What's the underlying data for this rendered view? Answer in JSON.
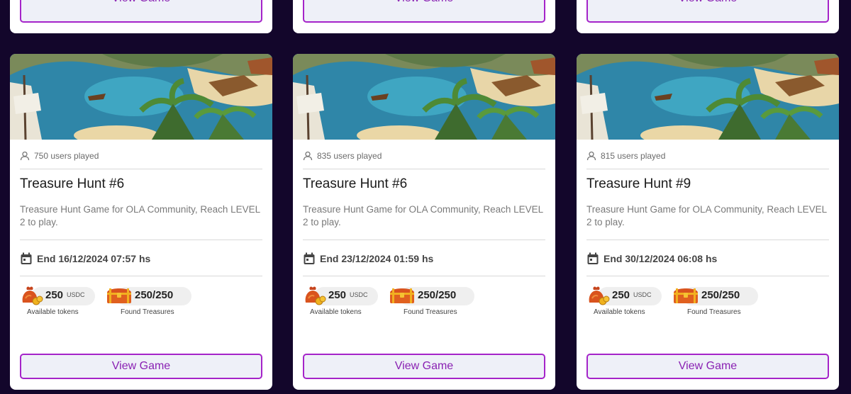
{
  "top_row": {
    "cards": [
      {
        "button_label": "View Game"
      },
      {
        "button_label": "View Game"
      },
      {
        "button_label": "View Game"
      }
    ]
  },
  "cards": [
    {
      "players": "750 users played",
      "title": "Treasure Hunt #6",
      "description": "Treasure Hunt Game for OLA Community, Reach LEVEL 2 to play.",
      "end_date": "End 16/12/2024 07:57 hs",
      "tokens_value": "250",
      "tokens_unit": "USDC",
      "tokens_label": "Available tokens",
      "treasures_value": "250/250",
      "treasures_label": "Found Treasures",
      "button_label": "View Game"
    },
    {
      "players": "835 users played",
      "title": "Treasure Hunt #6",
      "description": "Treasure Hunt Game for OLA Community, Reach LEVEL 2 to play.",
      "end_date": "End 23/12/2024 01:59 hs",
      "tokens_value": "250",
      "tokens_unit": "USDC",
      "tokens_label": "Available tokens",
      "treasures_value": "250/250",
      "treasures_label": "Found Treasures",
      "button_label": "View Game"
    },
    {
      "players": "815 users played",
      "title": "Treasure Hunt #9",
      "description": "Treasure Hunt Game for OLA Community, Reach LEVEL 2 to play.",
      "end_date": "End 30/12/2024 06:08 hs",
      "tokens_value": "250",
      "tokens_unit": "USDC",
      "tokens_label": "Available tokens",
      "treasures_value": "250/250",
      "treasures_label": "Found Treasures",
      "button_label": "View Game"
    }
  ],
  "colors": {
    "background": "#13062b",
    "button_border": "#a524c9",
    "button_text": "#8a22b3"
  }
}
